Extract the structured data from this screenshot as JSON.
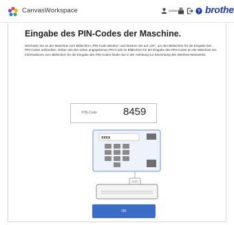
{
  "header": {
    "app_title": "CanvasWorkspace",
    "user_name": "xxxxxx",
    "icons": [
      "user-icon",
      "layers-icon",
      "logout-icon",
      "help-icon"
    ],
    "brand": "brother"
  },
  "main": {
    "heading": "Eingabe des PIN-Codes der Maschine.",
    "description": "Wechseln Sie an der Maschine zum Bildschirm „PIN-Code abrufen“ und drücken Sie auf „OK“, um den Bildschirm für die Eingabe des PIN-Codes aufzurufen. Geben Sie den unten angegebenen PIN-Code im Bildschirm für die Eingabe des PIN-Codes an der Maschine ein. Informationen zum Bildschirm für die Eingabe des PIN-Codes finden Sie in der Anleitung zur Einrichtung des Wireless-Netzwerks.",
    "pin_label": "PIN-Code",
    "pin_value": "8459",
    "screen_placeholder": "xxxx",
    "ok_label": "OK"
  },
  "colors": {
    "accent": "#3a6cc8",
    "brand": "#1f3d9a",
    "screen_frame": "#6a8fd0"
  }
}
